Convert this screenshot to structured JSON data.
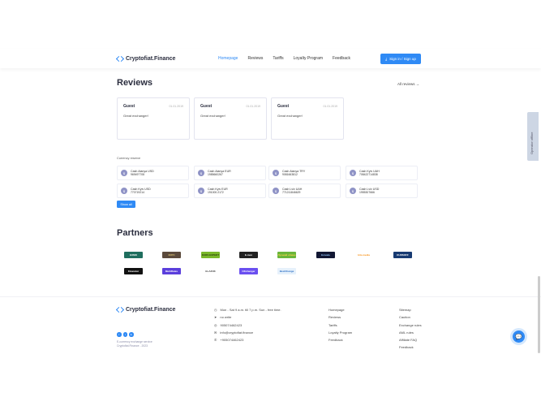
{
  "header": {
    "brand": "Cryptofiat.Finance",
    "nav": [
      "Homepage",
      "Reviews",
      "Tariffs",
      "Loyalty Program",
      "Feedback"
    ],
    "active": "Homepage",
    "sign_btn": "Sign in / Sign up"
  },
  "reviews": {
    "title": "Reviews",
    "all_link": "All reviews →",
    "items": [
      {
        "name": "Guest",
        "date": "01.01.2019",
        "text": "Great exchanger!"
      },
      {
        "name": "Guest",
        "date": "01.01.2019",
        "text": "Great exchanger!"
      },
      {
        "name": "Guest",
        "date": "01.01.2019",
        "text": "Great exchanger!"
      }
    ]
  },
  "reserve": {
    "label": "Currency reserve",
    "items": [
      {
        "name": "Cash Alanya USD",
        "amount": "969497708"
      },
      {
        "name": "Cash Alanya EUR",
        "amount": "1985660267"
      },
      {
        "name": "Cash Alanya TRY",
        "amount": "9081663812"
      },
      {
        "name": "Cash Kyiv UAH",
        "amount": "708422714838"
      },
      {
        "name": "Cash Kyiv USD",
        "amount": "770719214"
      },
      {
        "name": "Cash Kyiv EUR",
        "amount": "191000.2172"
      },
      {
        "name": "Cash Lviv UAH",
        "amount": "771211846629"
      },
      {
        "name": "Cash Lviv USD",
        "amount": "1955307666"
      }
    ],
    "show_all": "Show all"
  },
  "partners": {
    "title": "Partners",
    "items": [
      {
        "label": "EXMO",
        "bg": "#1f6e5e",
        "fg": "#fff"
      },
      {
        "label": "XRPC",
        "bg": "#5b4a3c",
        "fg": "#d8c070"
      },
      {
        "label": "KURS EXPERT",
        "bg": "#7ab82a",
        "fg": "#2a3a0a"
      },
      {
        "label": "E-mon",
        "bg": "#222",
        "fg": "#fff"
      },
      {
        "label": "Лучший обмен",
        "bg": "#6ab63a",
        "fg": "#ffd24a"
      },
      {
        "label": "Exnode",
        "bg": "#111733",
        "fg": "#9cf"
      },
      {
        "label": "bits.media",
        "bg": "#fff",
        "fg": "#f7931a"
      },
      {
        "label": "KURSOFF",
        "bg": "#173a72",
        "fg": "#fff"
      },
      {
        "label": "Financier",
        "bg": "#111",
        "fg": "#fff"
      },
      {
        "label": "MultiRates",
        "bg": "#5b3fdc",
        "fg": "#fff"
      },
      {
        "label": "GLAZOK",
        "bg": "#fff",
        "fg": "#444"
      },
      {
        "label": "OKchanger",
        "bg": "#6a4ff0",
        "fg": "#fff"
      },
      {
        "label": "BestChange",
        "bg": "#e6f1fb",
        "fg": "#2a6dc4"
      }
    ]
  },
  "footer": {
    "brand": "Cryptofiat.Finance",
    "contacts": [
      {
        "icon": "clock",
        "text": "Mon - Sat 9 a.m. till 7 p.m. Sun - free time."
      },
      {
        "icon": "telegram",
        "text": "no write"
      },
      {
        "icon": "viber",
        "text": "905074462423"
      },
      {
        "icon": "mail",
        "text": "info@cryptofiat.finance"
      },
      {
        "icon": "phone",
        "text": "+905074462423"
      }
    ],
    "links1": [
      "Homepage",
      "Reviews",
      "Tariffs",
      "Loyalty Program",
      "Feedback"
    ],
    "links2": [
      "Sitemap",
      "Caution",
      "Exchange rules",
      "AML rules",
      "Affiliate FAQ",
      "Feedback"
    ],
    "copy1": "E-currency exchange service",
    "copy2": "Cryptofiat.Finance - 2023"
  },
  "side_tab": "Operator offline",
  "colors": {
    "accent": "#2f8af5"
  }
}
